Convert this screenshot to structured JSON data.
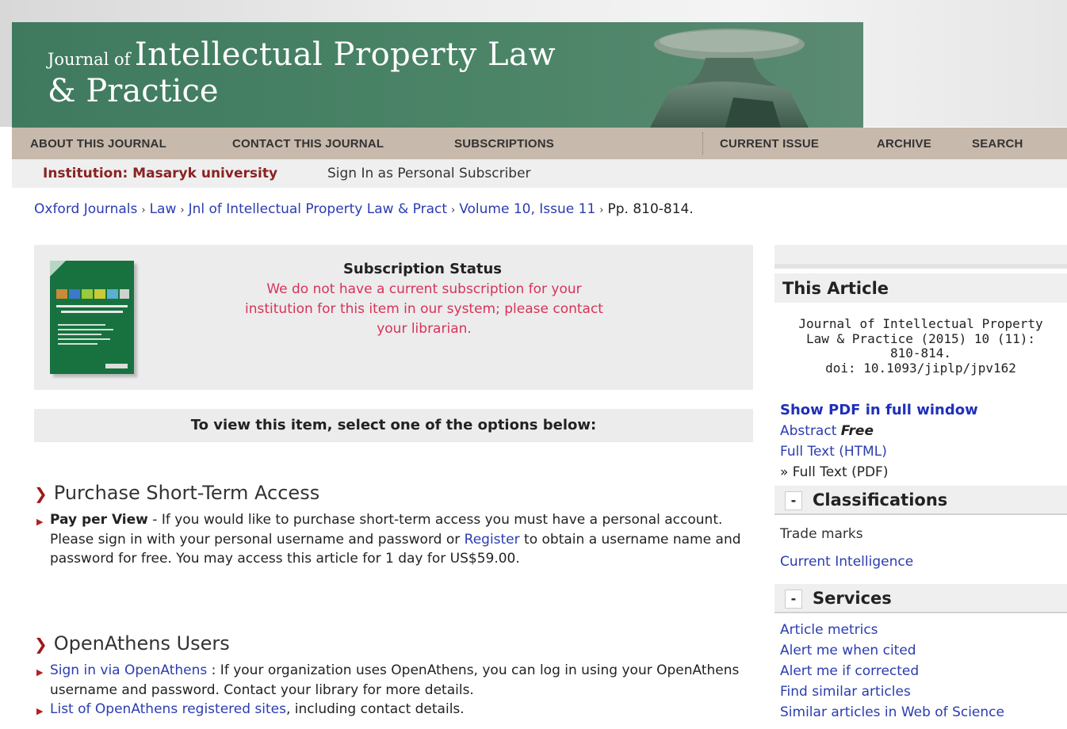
{
  "header": {
    "journal_small": "Journal of",
    "journal_big": "Intellectual Property Law",
    "journal_line2": "& Practice"
  },
  "nav": {
    "about": "ABOUT THIS JOURNAL",
    "contact": "CONTACT THIS JOURNAL",
    "subscriptions": "SUBSCRIPTIONS",
    "current_issue": "CURRENT ISSUE",
    "archive": "ARCHIVE",
    "search": "SEARCH"
  },
  "institution": {
    "label": "Institution: Masaryk university",
    "signin": "Sign In as Personal Subscriber"
  },
  "breadcrumb": {
    "items": [
      "Oxford Journals",
      "Law",
      "Jnl of Intellectual Property Law & Pract",
      "Volume 10, Issue 11"
    ],
    "current": "Pp. 810-814.",
    "sep": "›"
  },
  "subscription": {
    "title": "Subscription Status",
    "message": "We do not have a current subscription for your institution for this item in our system; please contact your librarian."
  },
  "options_heading": "To view this item, select one of the options below:",
  "purchase": {
    "heading": "Purchase Short-Term Access",
    "lead": "Pay per View",
    "text1": " - If you would like to purchase short-term access you must have a personal account. Please sign in with your personal username and password or ",
    "register": "Register",
    "text2": " to obtain a username name and password for free. You may access this article for 1 day for US$59.00."
  },
  "openathens": {
    "heading": "OpenAthens Users",
    "signin_link": "Sign in via OpenAthens",
    "signin_text": " : If your organization uses OpenAthens, you can log in using your OpenAthens username and password. Contact your library for more details.",
    "list_link": "List of OpenAthens registered sites",
    "list_text": ", including contact details."
  },
  "sidebar": {
    "this_article": "This Article",
    "citation": [
      "Journal of Intellectual Property",
      "Law & Practice (2015) 10 (11):",
      "810-814.",
      "doi: 10.1093/jiplp/jpv162"
    ],
    "show_pdf": "Show PDF in full window",
    "abstract": "Abstract",
    "free": "Free",
    "full_text_html": "Full Text (HTML)",
    "full_text_pdf": "» Full Text (PDF)",
    "classifications": {
      "toggle": "-",
      "label": "Classifications",
      "items": [
        "Trade marks",
        "Current Intelligence"
      ]
    },
    "services": {
      "toggle": "-",
      "label": "Services",
      "items": [
        "Article metrics",
        "Alert me when cited",
        "Alert me if corrected",
        "Find similar articles",
        "Similar articles in Web of Science"
      ]
    }
  },
  "colors": {
    "masthead_green": "#4b8467",
    "nav_tan": "#c7b9ab",
    "institution_red": "#8a2323",
    "alert_pink": "#d6335a",
    "link_blue": "#2a3cb0"
  }
}
